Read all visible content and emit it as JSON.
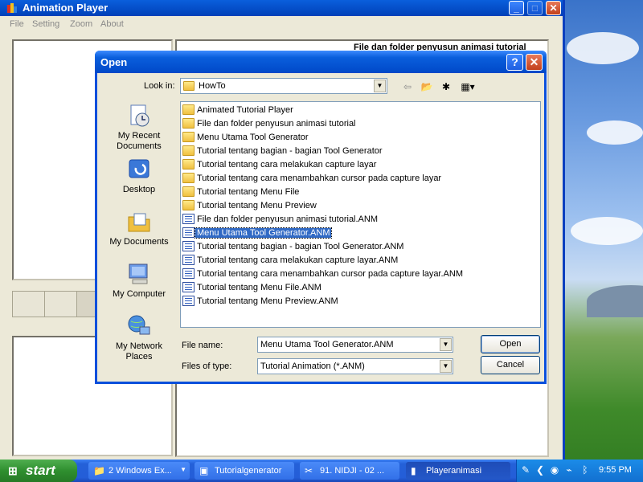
{
  "app": {
    "title": "Animation Player",
    "menu": [
      "File",
      "Setting",
      "Zoom",
      "About"
    ],
    "background_text": "File dan folder penyusun animasi tutorial"
  },
  "dialog": {
    "title": "Open",
    "help_glyph": "?",
    "close_glyph": "✕",
    "look_in_label": "Look in:",
    "look_in_value": "HowTo",
    "places": [
      {
        "label": "My Recent Documents",
        "icon": "recent-documents-icon"
      },
      {
        "label": "Desktop",
        "icon": "desktop-icon"
      },
      {
        "label": "My Documents",
        "icon": "my-documents-icon"
      },
      {
        "label": "My Computer",
        "icon": "my-computer-icon"
      },
      {
        "label": "My Network Places",
        "icon": "network-places-icon"
      }
    ],
    "files": [
      {
        "name": "Animated Tutorial Player",
        "type": "folder"
      },
      {
        "name": "File dan folder penyusun animasi tutorial",
        "type": "folder"
      },
      {
        "name": "Menu Utama Tool Generator",
        "type": "folder"
      },
      {
        "name": "Tutorial tentang bagian - bagian Tool Generator",
        "type": "folder"
      },
      {
        "name": "Tutorial tentang cara melakukan capture layar",
        "type": "folder"
      },
      {
        "name": "Tutorial tentang cara menambahkan cursor pada capture layar",
        "type": "folder"
      },
      {
        "name": "Tutorial tentang Menu File",
        "type": "folder"
      },
      {
        "name": "Tutorial tentang Menu Preview",
        "type": "folder"
      },
      {
        "name": "File dan folder penyusun animasi tutorial.ANM",
        "type": "file"
      },
      {
        "name": "Menu Utama Tool Generator.ANM",
        "type": "file",
        "selected": true
      },
      {
        "name": "Tutorial tentang bagian - bagian Tool Generator.ANM",
        "type": "file"
      },
      {
        "name": "Tutorial tentang cara melakukan capture layar.ANM",
        "type": "file"
      },
      {
        "name": "Tutorial tentang cara menambahkan cursor pada capture layar.ANM",
        "type": "file"
      },
      {
        "name": "Tutorial tentang Menu File.ANM",
        "type": "file"
      },
      {
        "name": "Tutorial tentang Menu Preview.ANM",
        "type": "file"
      }
    ],
    "file_name_label": "File name:",
    "file_name_value": "Menu Utama Tool Generator.ANM",
    "file_type_label": "Files of type:",
    "file_type_value": "Tutorial Animation (*.ANM)",
    "open_label": "Open",
    "cancel_label": "Cancel"
  },
  "taskbar": {
    "start_label": "start",
    "tasks": [
      {
        "label": "2 Windows Ex...",
        "icon": "folder-icon"
      },
      {
        "label": "Tutorialgenerator",
        "icon": "app-icon"
      },
      {
        "label": "91. NIDJI - 02 ...",
        "icon": "media-icon"
      },
      {
        "label": "Playeranimasi",
        "icon": "animation-player-icon",
        "active": true
      }
    ],
    "clock": "9:55 PM"
  },
  "colors": {
    "titlebar": "#0a5fdc",
    "selection": "#316ac5",
    "taskbar": "#245ed8",
    "start": "#2f8f2f",
    "window_face": "#ece9d8"
  }
}
